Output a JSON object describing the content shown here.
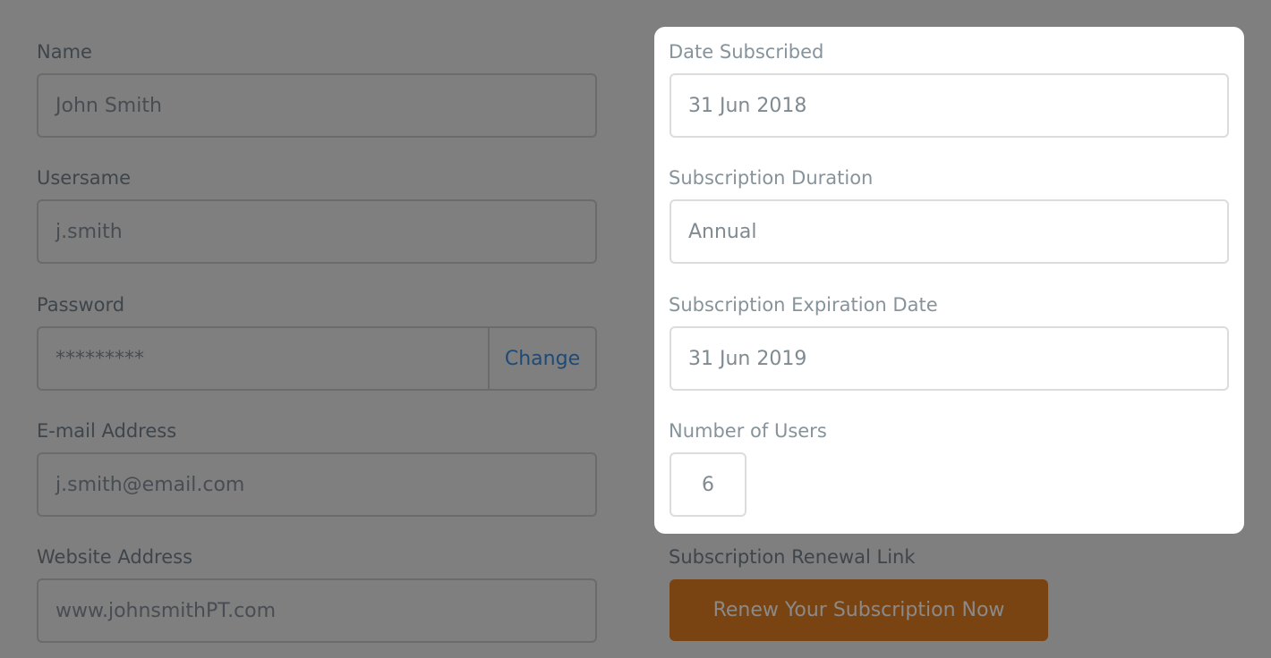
{
  "left": {
    "name": {
      "label": "Name",
      "value": "John Smith"
    },
    "username": {
      "label": "Usersame",
      "value": "j.smith"
    },
    "password": {
      "label": "Password",
      "value": "*********",
      "change_label": "Change"
    },
    "email": {
      "label": "E-mail Address",
      "value": "j.smith@email.com"
    },
    "website": {
      "label": "Website Address",
      "value": "www.johnsmithPT.com"
    }
  },
  "subscription": {
    "date_subscribed": {
      "label": "Date Subscribed",
      "value": "31 Jun 2018"
    },
    "duration": {
      "label": "Subscription Duration",
      "value": "Annual"
    },
    "expiration": {
      "label": "Subscription Expiration Date",
      "value": "31 Jun 2019"
    },
    "users": {
      "label": "Number of Users",
      "value": "6"
    },
    "renewal": {
      "label": "Subscription Renewal Link",
      "button_label": "Renew Your Subscription Now"
    }
  },
  "colors": {
    "overlay": "#7f7f7f",
    "highlight_panel": "#ffffff",
    "renew_button": "#7a4312",
    "link": "#1d4a78"
  }
}
